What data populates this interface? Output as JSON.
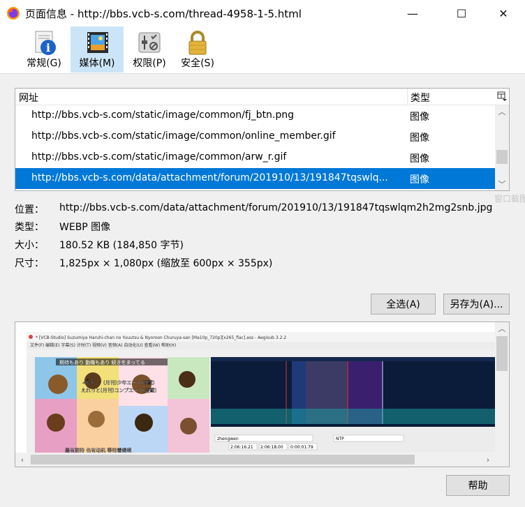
{
  "window": {
    "title": "页面信息 - http://bbs.vcb-s.com/thread-4958-1-5.html",
    "minimize_glyph": "—",
    "maximize_glyph": "☐",
    "close_glyph": "✕"
  },
  "toolbar": {
    "tabs": [
      {
        "label": "常规(G)",
        "icon": "info-icon",
        "active": false
      },
      {
        "label": "媒体(M)",
        "icon": "media-icon",
        "active": true
      },
      {
        "label": "权限(P)",
        "icon": "permissions-icon",
        "active": false
      },
      {
        "label": "安全(S)",
        "icon": "lock-icon",
        "active": false
      }
    ]
  },
  "media_list": {
    "header_address": "网址",
    "header_type": "类型",
    "rows": [
      {
        "url": "http://bbs.vcb-s.com/static/image/common/fj_btn.png",
        "type": "图像"
      },
      {
        "url": "http://bbs.vcb-s.com/static/image/common/online_member.gif",
        "type": "图像"
      },
      {
        "url": "http://bbs.vcb-s.com/static/image/common/arw_r.gif",
        "type": "图像"
      },
      {
        "url": "http://bbs.vcb-s.com/data/attachment/forum/201910/13/191847tqswlq...",
        "type": "图像",
        "selected": true
      }
    ]
  },
  "details": {
    "location_label": "位置：",
    "location_value": "http://bbs.vcb-s.com/data/attachment/forum/201910/13/191847tqswlqm2h2mg2snb.jpg",
    "type_label": "类型：",
    "type_value": "WEBP 图像",
    "size_label": "大小：",
    "size_value": "180.52 KB (184,850 字节)",
    "dimensions_label": "尺寸：",
    "dimensions_value": "1,825px × 1,080px (缩放至 600px × 355px)"
  },
  "buttons": {
    "select_all": "全选(A)",
    "save_as": "另存为(A)...",
    "help": "帮助"
  },
  "preview": {
    "window_title": "* [VCB-Studio] Suzumiya Haruhi-chan no Yuuutsu & Nyoroon Churuya-san [Ma10p_720p][x265_flac].ass - Aegisub 3.2.2",
    "menu": "文件(F)  编辑(E)  字幕(S)  计时(T)  视频(V)  音频(A)  自动化(U)  查看(W)  帮助(H)",
    "actor": "zhengwen",
    "start_time": "2:06:16.21",
    "end_time": "2:06:18.00",
    "duration": "0:00:01.79",
    "style": "NTP",
    "caption_1": "期待もあり 動機もあり 続きをまってる",
    "caption_2": "ぷよ",
    "caption_3": "(月刊)少年エース(連載)",
    "caption_4": "えれっと(月刊)コンプエース(連載)",
    "caption_5": "最有期待 也有动机 等待着继续",
    "faded_text": "窗口截图(F..."
  },
  "colors": {
    "accent": "#0078d7",
    "active_tab": "#cce4f7"
  }
}
